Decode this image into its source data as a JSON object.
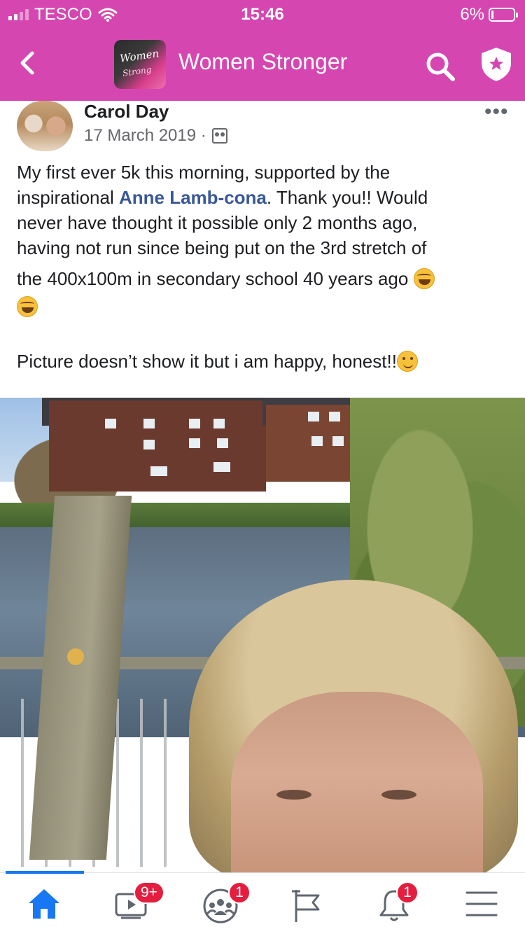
{
  "status_bar": {
    "carrier": "TESCO",
    "time": "15:46",
    "battery": "6%"
  },
  "nav": {
    "group_thumb_text_1": "Women",
    "group_thumb_text_2": "Strong",
    "group_name": "Women Stronger"
  },
  "post": {
    "author": "Carol Day",
    "date": "17 March 2019 ·",
    "line1": "My first ever 5k this morning, supported by the",
    "line2_prefix": "inspirational ",
    "mention": "Anne Lamb-cona",
    "line2_suffix": ". Thank you!! Would",
    "line3": "never have thought it possible only 2 months ago,",
    "line4": "having not run since being put on the 3rd stretch of",
    "line5": "the 400x100m in secondary school 40 years ago",
    "line7": "Picture doesn’t show it but i am happy, honest!!"
  },
  "tabbar": {
    "video_badge": "9+",
    "groups_badge": "1",
    "notifications_badge": "1"
  },
  "colors": {
    "header_bg": "#d646b0",
    "mention": "#385898",
    "active_tab": "#1877f2",
    "badge": "#e41e3f"
  },
  "icons": {
    "back": "chevron-left-icon",
    "search": "search-icon",
    "admin": "shield-star-icon",
    "home": "home-icon",
    "video": "video-icon",
    "groups": "groups-icon",
    "pages": "flag-icon",
    "notifications": "bell-icon",
    "menu": "hamburger-icon"
  }
}
